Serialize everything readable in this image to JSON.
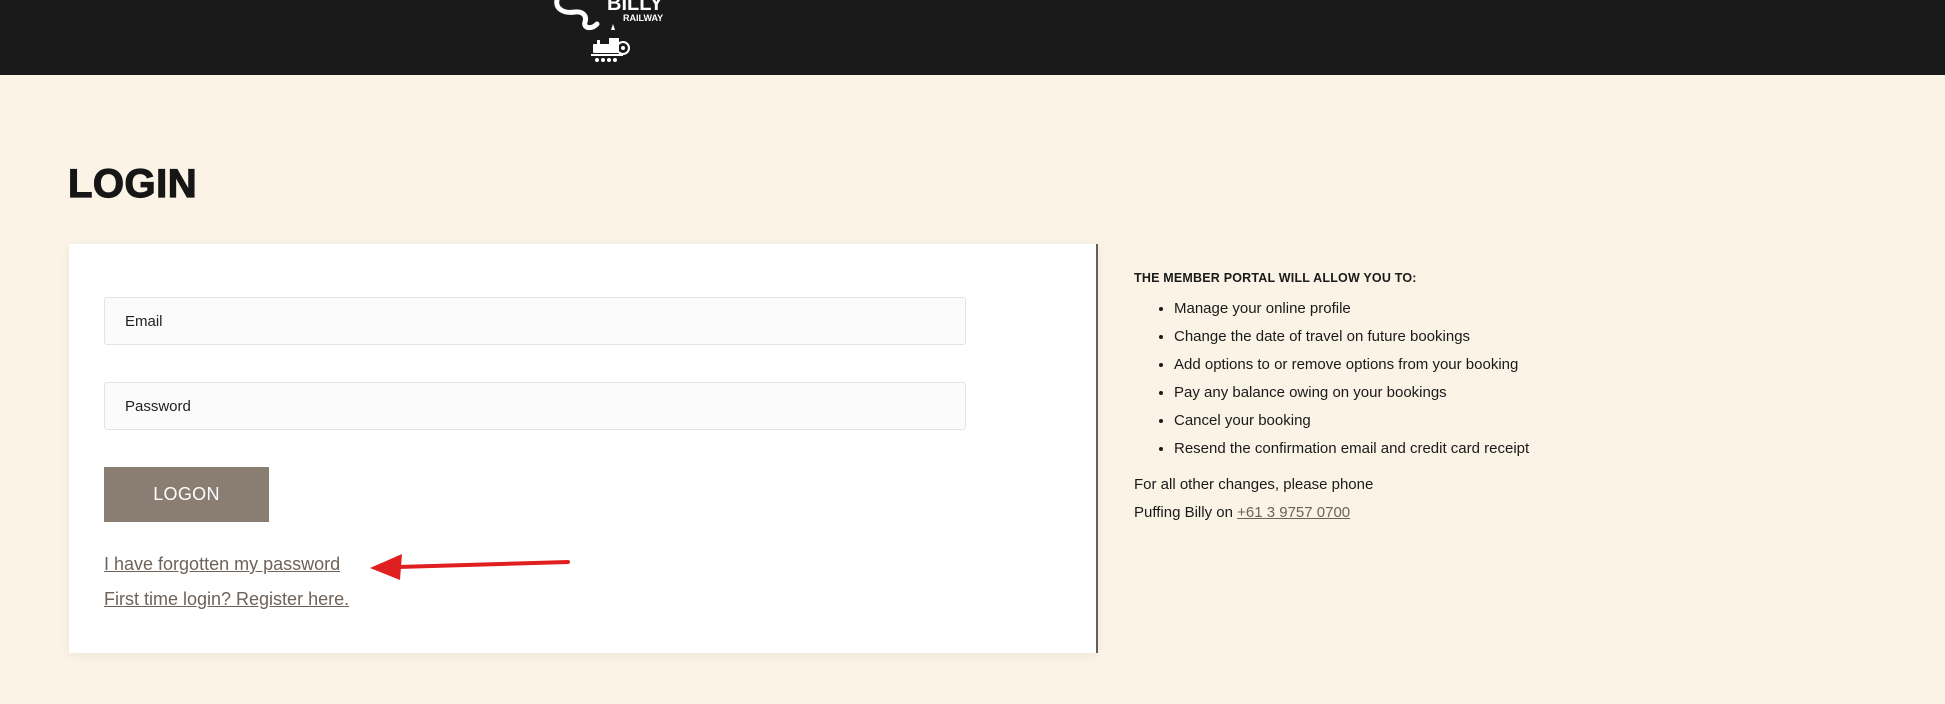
{
  "header": {
    "logo_text_top": "BILLY",
    "logo_text_bottom": "RAILWAY"
  },
  "page": {
    "title": "LOGIN"
  },
  "form": {
    "email_placeholder": "Email",
    "password_placeholder": "Password",
    "logon_label": "LOGON",
    "forgot_label": "I have forgotten my password",
    "register_label": "First time login? Register here."
  },
  "info": {
    "heading": "THE MEMBER PORTAL WILL ALLOW YOU TO:",
    "items": [
      "Manage your online profile",
      "Change the date of travel on future bookings",
      "Add options to or remove options from your booking",
      "Pay any balance owing on your bookings",
      "Cancel your booking",
      "Resend the confirmation email and credit card receipt"
    ],
    "note_line1": "For all other changes, please phone",
    "note_line2_prefix": "Puffing Billy on",
    "phone": "+61 3 9757 0700"
  },
  "colors": {
    "header_bg": "#1a1a1a",
    "page_bg": "#faf3e6",
    "button_bg": "#8a7d72",
    "link": "#6e6259",
    "annotation_arrow": "#e02020"
  },
  "icons": {
    "logo": "puffing-billy-locomotive-logo",
    "annotation": "red-arrow-annotation"
  }
}
